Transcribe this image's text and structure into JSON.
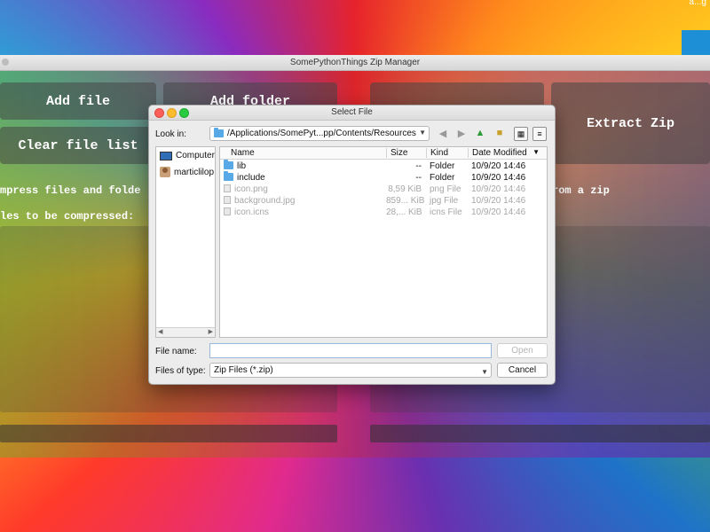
{
  "corner_text": "a...g",
  "app": {
    "title": "SomePythonThings Zip Manager",
    "buttons": {
      "add_file": "Add file",
      "add_folder": "Add folder",
      "clear_list": "Clear file list",
      "extract_zip": "Extract Zip"
    },
    "compress_text": "mpress files and folde",
    "files_text": "les to be compressed:",
    "extract_text": "rom a zip"
  },
  "dialog": {
    "title": "Select File",
    "look_in_label": "Look in:",
    "path": "/Applications/SomePyt...pp/Contents/Resources",
    "sidebar": [
      "Computer",
      "marticlilop"
    ],
    "columns": [
      "Name",
      "Size",
      "Kind",
      "Date Modified"
    ],
    "files": [
      {
        "name": "lib",
        "size": "--",
        "kind": "Folder",
        "date": "10/9/20 14:46",
        "type": "folder",
        "enabled": true
      },
      {
        "name": "include",
        "size": "--",
        "kind": "Folder",
        "date": "10/9/20 14:46",
        "type": "folder",
        "enabled": true
      },
      {
        "name": "icon.png",
        "size": "8,59 KiB",
        "kind": "png File",
        "date": "10/9/20 14:46",
        "type": "file",
        "enabled": false
      },
      {
        "name": "background.jpg",
        "size": "859... KiB",
        "kind": "jpg File",
        "date": "10/9/20 14:46",
        "type": "file",
        "enabled": false
      },
      {
        "name": "icon.icns",
        "size": "28,... KiB",
        "kind": "icns File",
        "date": "10/9/20 14:46",
        "type": "file",
        "enabled": false
      }
    ],
    "file_name_label": "File name:",
    "file_name_value": "",
    "files_of_type_label": "Files of type:",
    "file_type_value": "Zip Files (*.zip)",
    "open_button": "Open",
    "cancel_button": "Cancel"
  },
  "colors": {
    "accent": "#58a9e8",
    "close": "#fc5f57",
    "minimize": "#fdbc2e",
    "maximize": "#29c940"
  }
}
